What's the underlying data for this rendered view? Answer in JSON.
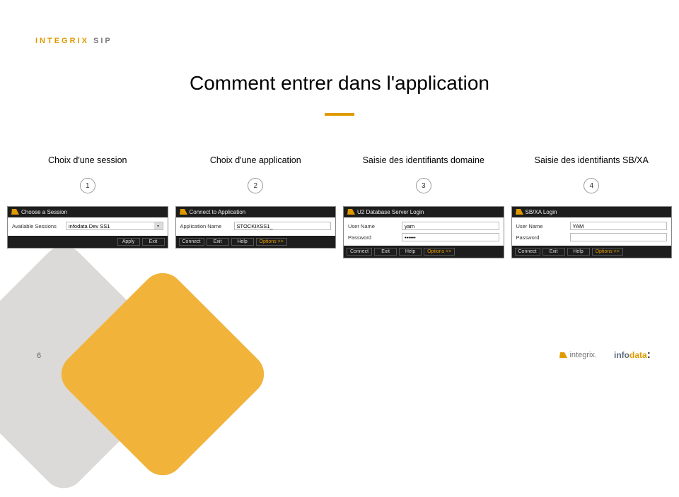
{
  "brand": {
    "main": "INTEGRIX",
    "sub": "SIP"
  },
  "title": "Comment entrer dans l'application",
  "slide_number": "6",
  "footer": {
    "logo1": "integrix.",
    "logo2_a": "info",
    "logo2_b": "data"
  },
  "steps": [
    {
      "label": "Choix d'une session",
      "num": "1",
      "dialog_title": "Choose a Session",
      "field_label": "Available Sessions",
      "field_value": "infodata Dev SS1",
      "buttons": [
        "Apply",
        "Exit"
      ],
      "buttons_align": "right"
    },
    {
      "label": "Choix d'une application",
      "num": "2",
      "dialog_title": "Connect to Application",
      "field_label": "Application Name",
      "field_value": "STOCKIXSS1_",
      "buttons": [
        "Connect",
        "Exit",
        "Help",
        "Options >>"
      ]
    },
    {
      "label": "Saisie des identifiants domaine",
      "num": "3",
      "dialog_title": "U2 Database Server Login",
      "rows": [
        {
          "lbl": "User Name",
          "val": "yam",
          "hl": true
        },
        {
          "lbl": "Password",
          "val": "••••••"
        }
      ],
      "buttons": [
        "Connect",
        "Exit",
        "Help",
        "Options >>"
      ]
    },
    {
      "label": "Saisie des identifiants SB/XA",
      "num": "4",
      "dialog_title": "SB/XA Login",
      "rows": [
        {
          "lbl": "User Name",
          "val": "YAM",
          "hl": true
        },
        {
          "lbl": "Password",
          "val": ""
        }
      ],
      "buttons": [
        "Connect",
        "Exit",
        "Help",
        "Options >>"
      ]
    }
  ]
}
